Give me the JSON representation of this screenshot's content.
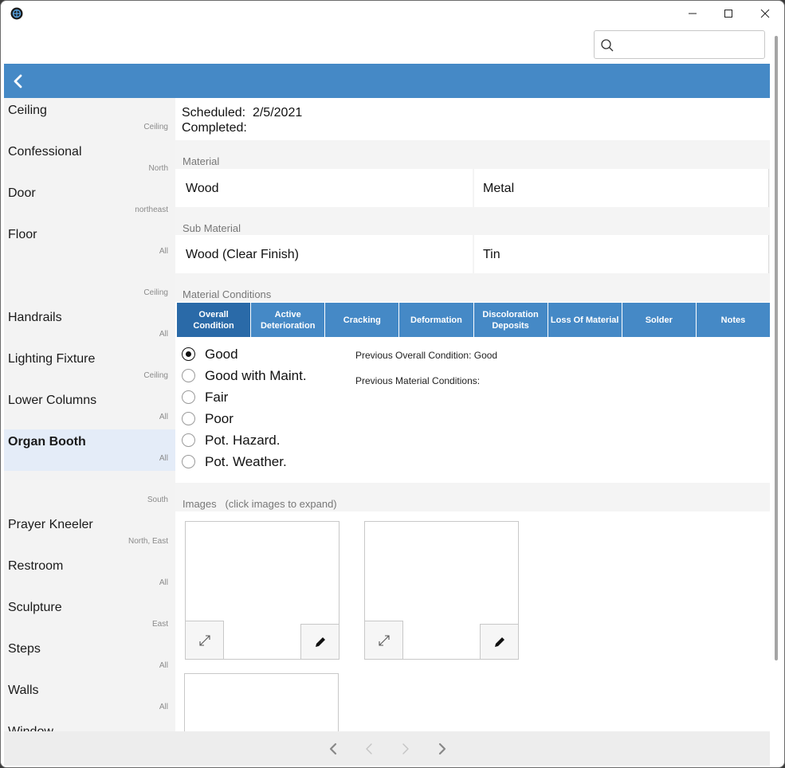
{
  "search": {
    "placeholder": "",
    "value": ""
  },
  "sidebar": {
    "items": [
      {
        "label": "Ceiling",
        "location": "Ceiling",
        "selected": false
      },
      {
        "label": "Confessional",
        "location": "North",
        "selected": false
      },
      {
        "label": "Door",
        "location": "northeast",
        "selected": false
      },
      {
        "label": "Floor",
        "location": "All",
        "selected": false
      },
      {
        "label": "",
        "location": "Ceiling",
        "selected": false
      },
      {
        "label": "Handrails",
        "location": "All",
        "selected": false
      },
      {
        "label": "Lighting Fixture",
        "location": "Ceiling",
        "selected": false
      },
      {
        "label": "Lower Columns",
        "location": "All",
        "selected": false
      },
      {
        "label": "Organ Booth",
        "location": "All",
        "selected": true
      },
      {
        "label": "",
        "location": "South",
        "selected": false
      },
      {
        "label": "Prayer Kneeler",
        "location": "North, East",
        "selected": false
      },
      {
        "label": "Restroom",
        "location": "All",
        "selected": false
      },
      {
        "label": "Sculpture",
        "location": "East",
        "selected": false
      },
      {
        "label": "Steps",
        "location": "All",
        "selected": false
      },
      {
        "label": "Walls",
        "location": "All",
        "selected": false
      },
      {
        "label": "Window",
        "location": "",
        "selected": false
      }
    ]
  },
  "main": {
    "scheduled_label": "Scheduled:",
    "scheduled_value": "2/5/2021",
    "completed_label": "Completed:",
    "completed_value": "",
    "material": {
      "header": "Material",
      "left": "Wood",
      "right": "Metal"
    },
    "sub_material": {
      "header": "Sub Material",
      "left": "Wood (Clear Finish)",
      "right": "Tin"
    },
    "conditions_header": "Material Conditions",
    "tabs": [
      {
        "label": "Overall Condition",
        "active": true
      },
      {
        "label": "Active Deterioration",
        "active": false
      },
      {
        "label": "Cracking",
        "active": false
      },
      {
        "label": "Deformation",
        "active": false
      },
      {
        "label": "Discoloration Deposits",
        "active": false
      },
      {
        "label": "Loss Of Material",
        "active": false
      },
      {
        "label": "Solder",
        "active": false
      },
      {
        "label": "Notes",
        "active": false
      }
    ],
    "conditions": [
      {
        "label": "Good",
        "checked": true
      },
      {
        "label": "Good with Maint.",
        "checked": false
      },
      {
        "label": "Fair",
        "checked": false
      },
      {
        "label": "Poor",
        "checked": false
      },
      {
        "label": "Pot. Hazard.",
        "checked": false
      },
      {
        "label": "Pot. Weather.",
        "checked": false
      }
    ],
    "previous_overall": "Previous Overall Condition: Good",
    "previous_material": "Previous Material Conditions:",
    "images_header": "Images   (click images to expand)"
  },
  "colors": {
    "accent": "#4589c6",
    "accent_active": "#2a6aa8",
    "sidebar_bg": "#f3f3f3",
    "selected_bg": "#e4ecf8"
  },
  "icons": {
    "app": "globe-icon",
    "back": "chevron-left-icon",
    "search": "search-icon",
    "expand": "expand-icon",
    "edit": "pencil-icon"
  }
}
